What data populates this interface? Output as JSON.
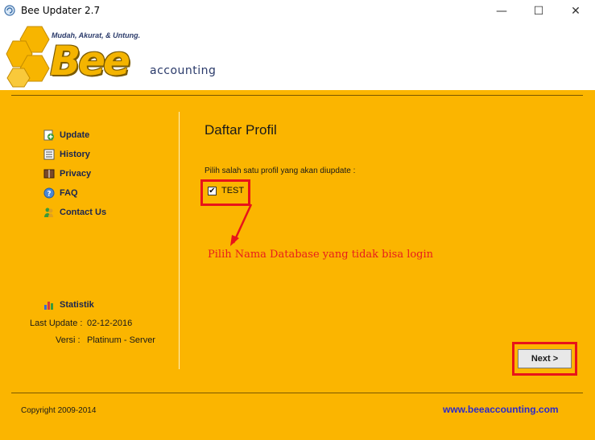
{
  "window": {
    "title": "Bee Updater 2.7",
    "controls": {
      "minimize": "—",
      "maximize": "☐",
      "close": "✕"
    }
  },
  "header": {
    "tagline": "Mudah, Akurat, & Untung.",
    "brand": "Bee",
    "subtitle": "accounting"
  },
  "sidebar": {
    "items": [
      {
        "label": "Update",
        "icon": "update-icon"
      },
      {
        "label": "History",
        "icon": "history-icon"
      },
      {
        "label": "Privacy",
        "icon": "privacy-icon"
      },
      {
        "label": "FAQ",
        "icon": "faq-icon"
      },
      {
        "label": "Contact Us",
        "icon": "contact-icon"
      }
    ],
    "statistik": {
      "label": "Statistik",
      "icon": "chart-icon"
    },
    "last_update_label": "Last Update :",
    "last_update_value": "02-12-2016",
    "versi_label": "Versi :",
    "versi_value": "Platinum - Server"
  },
  "content": {
    "heading": "Daftar Profil",
    "instruction": "Pilih salah satu profil yang akan diupdate :",
    "profile": {
      "label": "TEST",
      "checked": true
    },
    "annotation": "Pilih Nama Database yang tidak bisa login",
    "next_label": "Next >"
  },
  "footer": {
    "copyright": "Copyright 2009-2014",
    "website": "www.beeaccounting.com"
  },
  "colors": {
    "background": "#fbb500",
    "highlight": "#e8131a",
    "link": "#2b2bcc"
  }
}
